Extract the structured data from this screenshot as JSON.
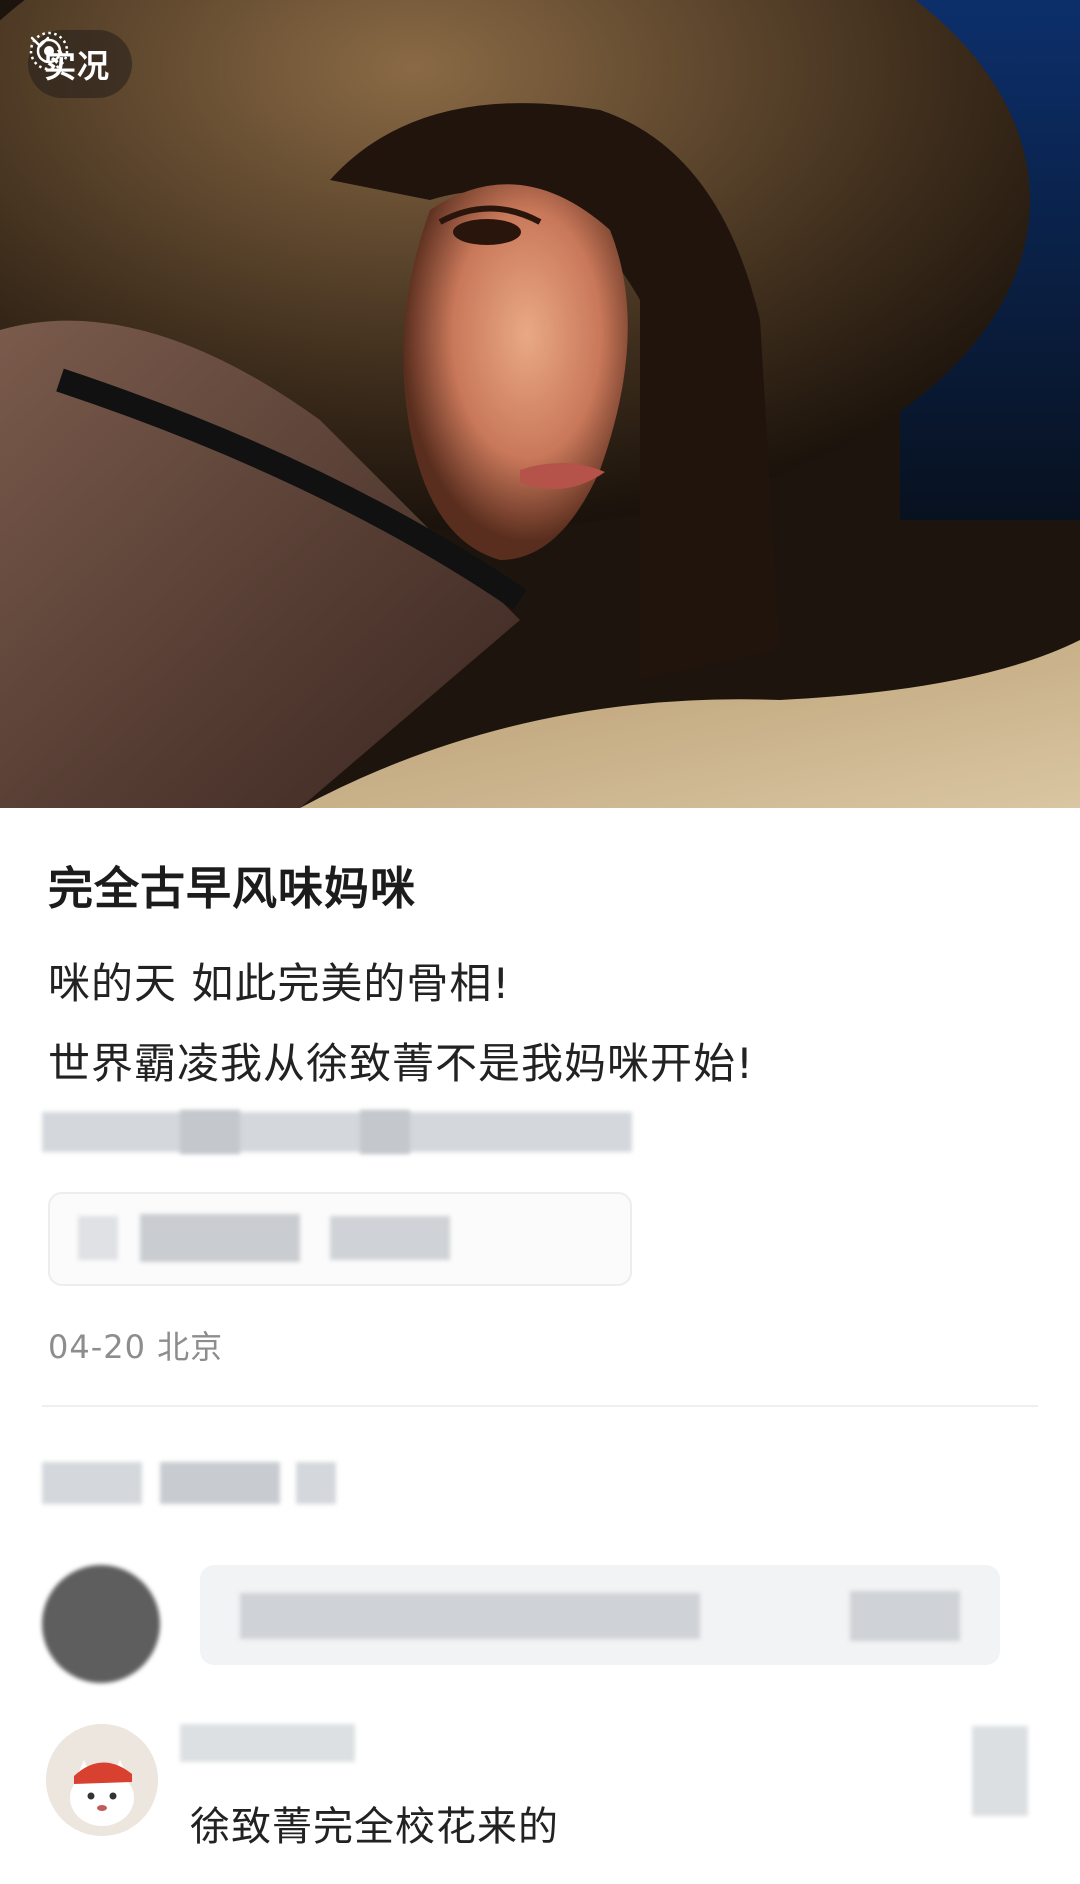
{
  "photo": {
    "badge": {
      "icon": "live-photo-icon",
      "label": "实况",
      "chevron": "chevron-down-icon"
    }
  },
  "post": {
    "title": "完全古早风味妈咪",
    "body_lines": [
      "咪的天 如此完美的骨相!",
      "世界霸凌我从徐致菁不是我妈咪开始!"
    ],
    "meta": "04-20  北京"
  },
  "comments": {
    "reply": {
      "text": "徐致菁完全校花来的",
      "avatar_icon": "cat-avatar-icon"
    }
  },
  "colors": {
    "accent_text": "#222222",
    "muted_text": "#8d8d8d",
    "divider": "#efefef"
  }
}
